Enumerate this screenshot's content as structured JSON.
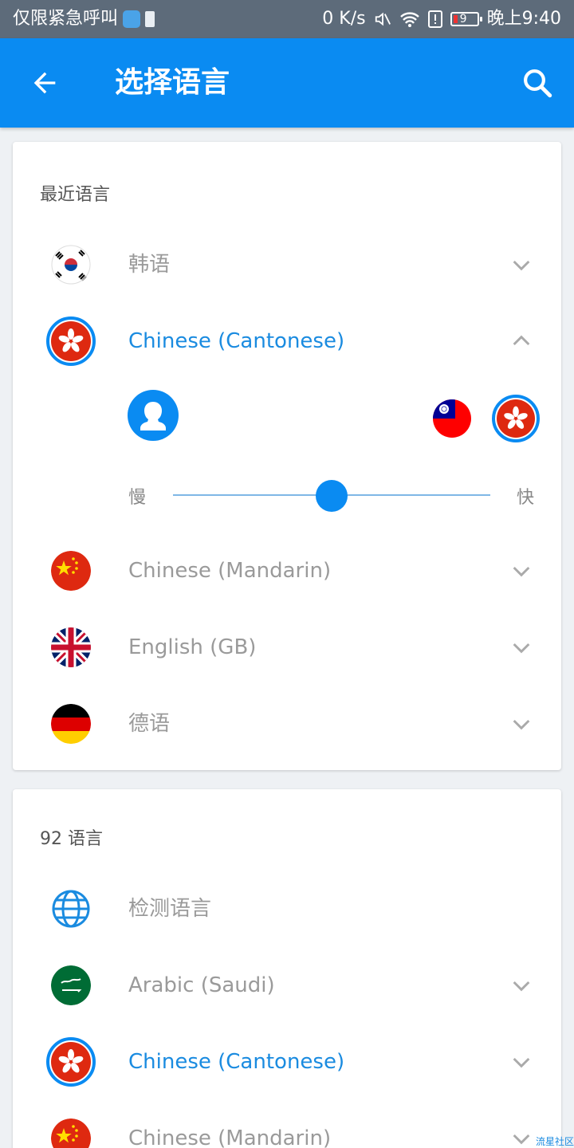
{
  "status_bar": {
    "left_text": "仅限紧急呼叫",
    "speed": "0 K/s",
    "battery": "9",
    "time": "晚上9:40"
  },
  "app_bar": {
    "title": "选择语言",
    "back_icon": "arrow-left-icon",
    "search_icon": "search-icon"
  },
  "recent": {
    "header": "最近语言",
    "items": [
      {
        "label": "韩语",
        "flag": "kr",
        "expanded": false,
        "selected": false
      },
      {
        "label": "Chinese (Cantonese)",
        "flag": "hk",
        "expanded": true,
        "selected": true
      },
      {
        "label": "Chinese (Mandarin)",
        "flag": "cn",
        "expanded": false,
        "selected": false
      },
      {
        "label": "English (GB)",
        "flag": "gb",
        "expanded": false,
        "selected": false
      },
      {
        "label": "德语",
        "flag": "de",
        "expanded": false,
        "selected": false
      }
    ],
    "voice_panel": {
      "slow_label": "慢",
      "fast_label": "快",
      "speed_value": 0.5,
      "voice_flags": [
        "tw",
        "hk"
      ]
    }
  },
  "all": {
    "header": "92 语言",
    "items": [
      {
        "label": "检测语言",
        "flag": "globe"
      },
      {
        "label": "Arabic (Saudi)",
        "flag": "sa"
      },
      {
        "label": "Chinese (Cantonese)",
        "flag": "hk",
        "selected": true
      },
      {
        "label": "Chinese (Mandarin)",
        "flag": "cn"
      }
    ]
  },
  "colors": {
    "accent": "#0a8bf2",
    "active_text": "#1a8be0",
    "inactive_text": "#9a9a9a"
  },
  "watermark": "流星社区"
}
